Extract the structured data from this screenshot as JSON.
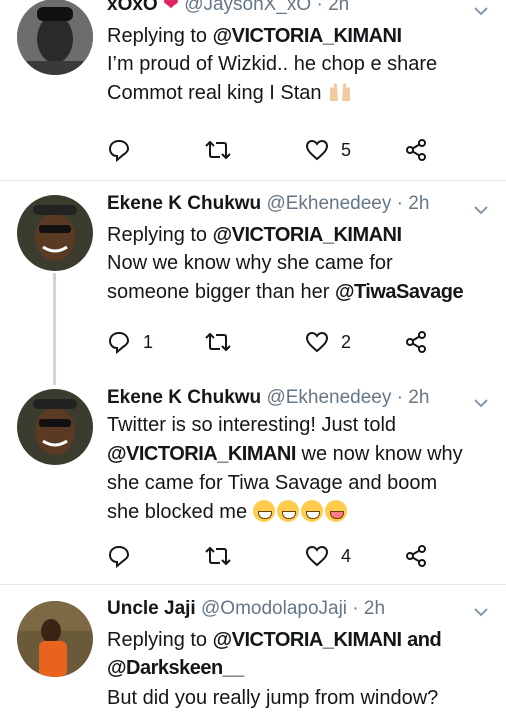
{
  "tweets": [
    {
      "name": "xOxO",
      "handle": "@JaysonX_xO",
      "time": "· 2h",
      "reply_prefix": "Replying to",
      "reply_to": "@VICTORIA_KIMANI",
      "text_lines": [
        "I’m proud of Wizkid.. he chop e share",
        "Commot real king I Stan"
      ],
      "reply_count": "",
      "retweet_count": "",
      "like_count": "5"
    },
    {
      "name": "Ekene K Chukwu",
      "handle": "@Ekhenedeey",
      "time": "· 2h",
      "reply_prefix": "Replying to",
      "reply_to": "@VICTORIA_KIMANI",
      "text_line1": "Now we know why she came for",
      "text_line2_prefix": "someone bigger than her",
      "text_line2_mention": "@TiwaSavage",
      "reply_count": "1",
      "retweet_count": "",
      "like_count": "2"
    },
    {
      "name": "Ekene K Chukwu",
      "handle": "@Ekhenedeey",
      "time": "· 2h",
      "text_line1": "Twitter is so interesting! Just told",
      "text_line2_mention": "@VICTORIA_KIMANI",
      "text_line2_rest": "we now know why",
      "text_line3": "she came for Tiwa Savage and boom",
      "text_line4": "she blocked me",
      "reply_count": "",
      "retweet_count": "",
      "like_count": "4"
    },
    {
      "name": "Uncle Jaji",
      "handle": "@OmodolapoJaji",
      "time": "· 2h",
      "reply_prefix": "Replying to",
      "reply_to": "@VICTORIA_KIMANI",
      "reply_and": "and",
      "reply_to2": "@Darkskeen__",
      "text": "But did you really jump from window?"
    }
  ],
  "colors": {
    "text": "#14171a",
    "secondary": "#657786",
    "divider": "#e1e8ed",
    "thread": "#ccd6dd"
  },
  "icons": [
    "reply-icon",
    "retweet-icon",
    "like-icon",
    "share-icon",
    "caret-down-icon"
  ]
}
